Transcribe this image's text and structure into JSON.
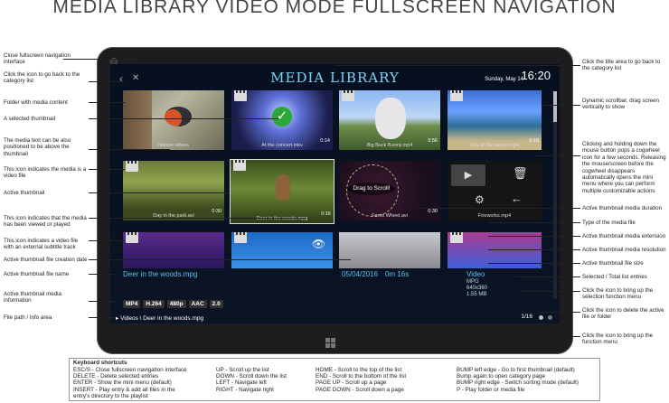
{
  "page_title": "MEDIA LIBRARY VIDEO MODE FULLSCREEN NAVIGATION",
  "screen": {
    "title": "MEDIA LIBRARY",
    "date": "Sunday, May 14",
    "time": "16:20",
    "thumbs": [
      {
        "label": "Nature videos",
        "dur": ""
      },
      {
        "label": "At the concert.mkv",
        "dur": "0:14"
      },
      {
        "label": "Big Buck Bunny.mp4",
        "dur": "9:56"
      },
      {
        "label": "Day at the beach.mp4",
        "dur": "0:18"
      },
      {
        "label": "Day in the park.avi",
        "dur": "0:30"
      },
      {
        "label": "Deer in the woods.mpg",
        "dur": "0:16"
      },
      {
        "label": "Ferris Wheel.avi",
        "dur": "0:30"
      },
      {
        "label": "Fireworks.mp4",
        "dur": ""
      },
      {
        "label": "",
        "dur": ""
      },
      {
        "label": "",
        "dur": ""
      },
      {
        "label": "",
        "dur": ""
      },
      {
        "label": "",
        "dur": ""
      }
    ],
    "drag_label": "Drag to Scroll!",
    "file_name": "Deer in the woods.mpg",
    "file_date": "05/04/2016",
    "file_duration": "0m 16s",
    "file_type": "Video",
    "file_ext": "MPG",
    "file_res": "640x360",
    "file_size": "1.55 MB",
    "tags": [
      "MP4",
      "H.264",
      "480p",
      "AAC",
      "2.0"
    ],
    "path": "Videos \\ Deer in the woods.mpg",
    "count": "1/16"
  },
  "left_annotations": [
    "Close fullscreen navigation interface",
    "Click the icon to go back to the category list",
    "Folder with media content",
    "A selected thumbnail",
    "The media text can be also positioned to be above the thumbnail",
    "This icon indicates the media is a video file",
    "Active thumbnail",
    "This icon indicates that the media has been viewed or played",
    "This icon indicates a video file with an external subtitle track",
    "Active thumbnail file creation date",
    "Active thumbnail file name",
    "Active thumbnail media information",
    "File path / Info area"
  ],
  "right_annotations": [
    "Click the title area to go back to the category list",
    "Dynamic scrollbar, drag screen vertically to show",
    "Clicking and holding down the mouse button pops a cogwheel icon for a few seconds. Releasing the mouse/screen before the cogwheel disappears automatically opens the mini menu where you can perform multiple customizable actions",
    "Active thumbnail media duration",
    "Type of the media file",
    "Active thumbnail media extension",
    "Active thumbnail media resolution",
    "Active thumbnail file size",
    "Selected / Total list entries",
    "Click the icon to bring up the selection function menu",
    "Click the icon to delete the active file or folder",
    "Click the icon to bring up the function menu"
  ],
  "shortcuts": {
    "title": "Keyboard shortcuts",
    "col1": [
      "ESC/S      -   Close fullscreen navigation interface",
      "DELETE    -   Delete selected entries",
      "ENTER     -   Show the mini menu (default)",
      "INSERT    -   Play entry & add all files in the",
      "                   entry's directory to the playlist"
    ],
    "col2": [
      "UP          -   Scroll up the list",
      "DOWN      -   Scroll down the list",
      "LEFT        -   Navigate left",
      "RIGHT      -   Navigate right"
    ],
    "col3": [
      "HOME         -   Scroll to the top of the list",
      "END            -   Scroll to the bottom of the list",
      "PAGE UP      -   Scroll up a page",
      "PAGE DOWN  -   Scroll down a page"
    ],
    "col4": [
      "BUMP left edge  - Go to first thumbnail (default)",
      "                          Bump again to open category page",
      "BUMP right edge  - Switch sorting mode (default)",
      "P                       - Play folder or media file"
    ]
  }
}
